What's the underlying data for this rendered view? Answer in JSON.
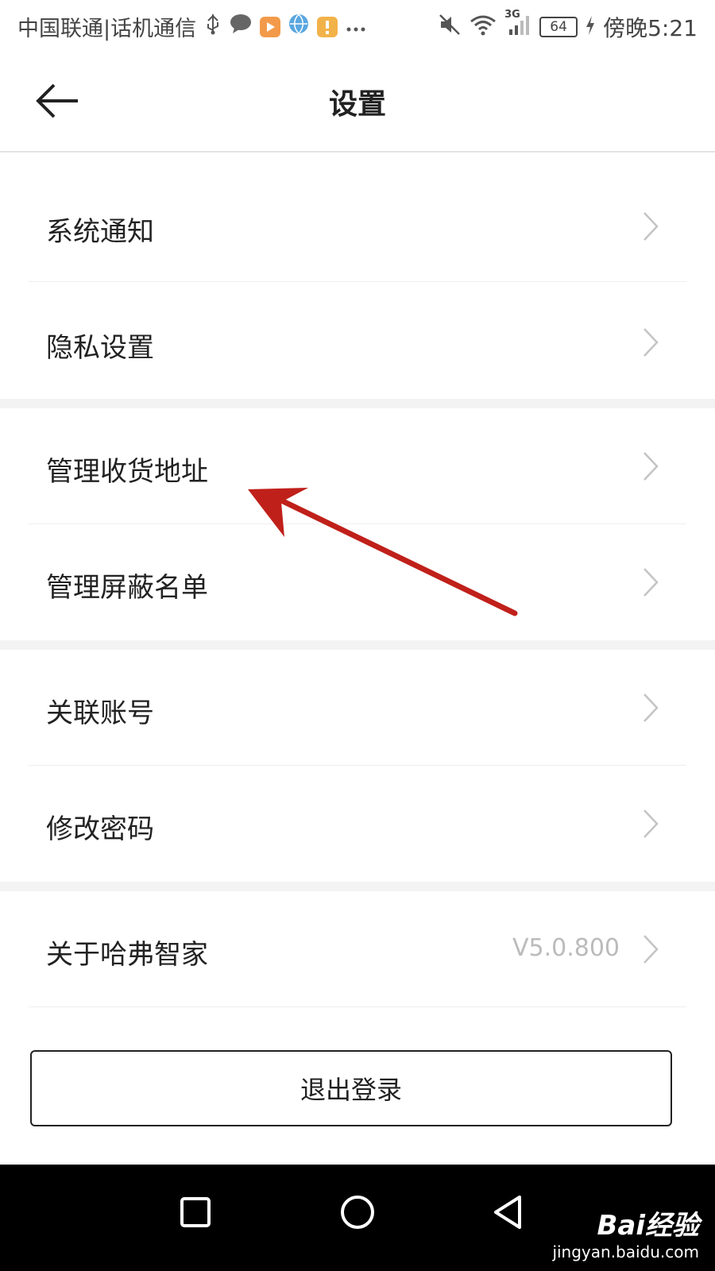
{
  "status_bar": {
    "carrier": "中国联通|话机通信",
    "network": "3G",
    "battery": "64",
    "time": "傍晚5:21"
  },
  "header": {
    "title": "设置"
  },
  "settings": {
    "items": [
      {
        "label": "系统通知"
      },
      {
        "label": "隐私设置"
      },
      {
        "label": "管理收货地址"
      },
      {
        "label": "管理屏蔽名单"
      },
      {
        "label": "关联账号"
      },
      {
        "label": "修改密码"
      },
      {
        "label": "关于哈弗智家",
        "value": "V5.0.800"
      }
    ]
  },
  "logout_label": "退出登录",
  "watermark": {
    "logo": "Bai经验",
    "sub": "jingyan.baidu.com"
  },
  "colors": {
    "annotation_arrow": "#c0201a",
    "separator": "#f3f3f3",
    "value_text": "#bbbbbb"
  }
}
